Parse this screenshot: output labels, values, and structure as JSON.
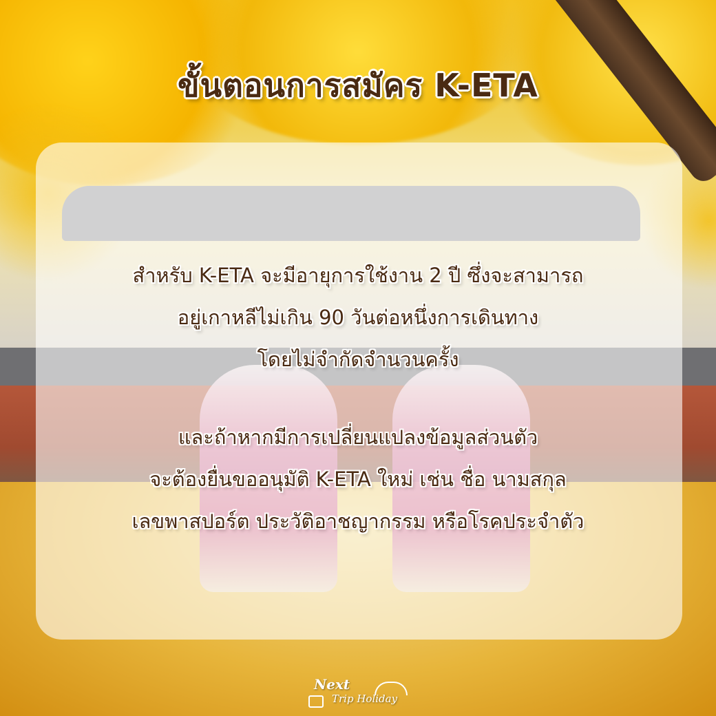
{
  "title": "ขั้นตอนการสมัคร K-ETA",
  "paragraph_1": [
    "สำหรับ K-ETA จะมีอายุการใช้งาน 2 ปี ซึ่งจะสามารถ",
    "อยู่เกาหลีไม่เกิน 90 วันต่อหนึ่งการเดินทาง",
    "โดยไม่จำกัดจำนวนครั้ง"
  ],
  "paragraph_2": [
    "และถ้าหากมีการเปลี่ยนแปลงข้อมูลส่วนตัว",
    "จะต้องยื่นขออนุมัติ K-ETA ใหม่ เช่น ชื่อ นามสกุล",
    "เลขพาสปอร์ต ประวัติอาชญากรรม หรือโรคประจำตัว"
  ],
  "logo": {
    "line_1": "Next",
    "line_2": "Trip Holiday"
  },
  "colors": {
    "text": "#4a2a12",
    "card": "rgba(255,255,255,0.60)"
  }
}
